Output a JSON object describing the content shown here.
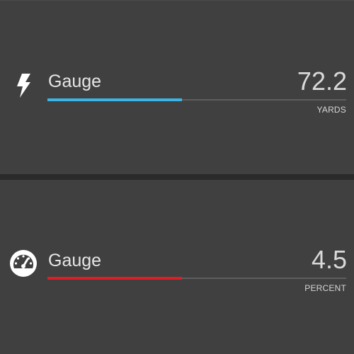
{
  "gauges": [
    {
      "icon": "lightning-bolt-icon",
      "label": "Gauge",
      "value": "72.2",
      "unit": "YARDS",
      "fill_fraction": 0.45,
      "color": "#3bb4e6"
    },
    {
      "icon": "speedometer-icon",
      "label": "Gauge",
      "value": "4.5",
      "unit": "PERCENT",
      "fill_fraction": 0.45,
      "color": "#e01c24"
    }
  ]
}
